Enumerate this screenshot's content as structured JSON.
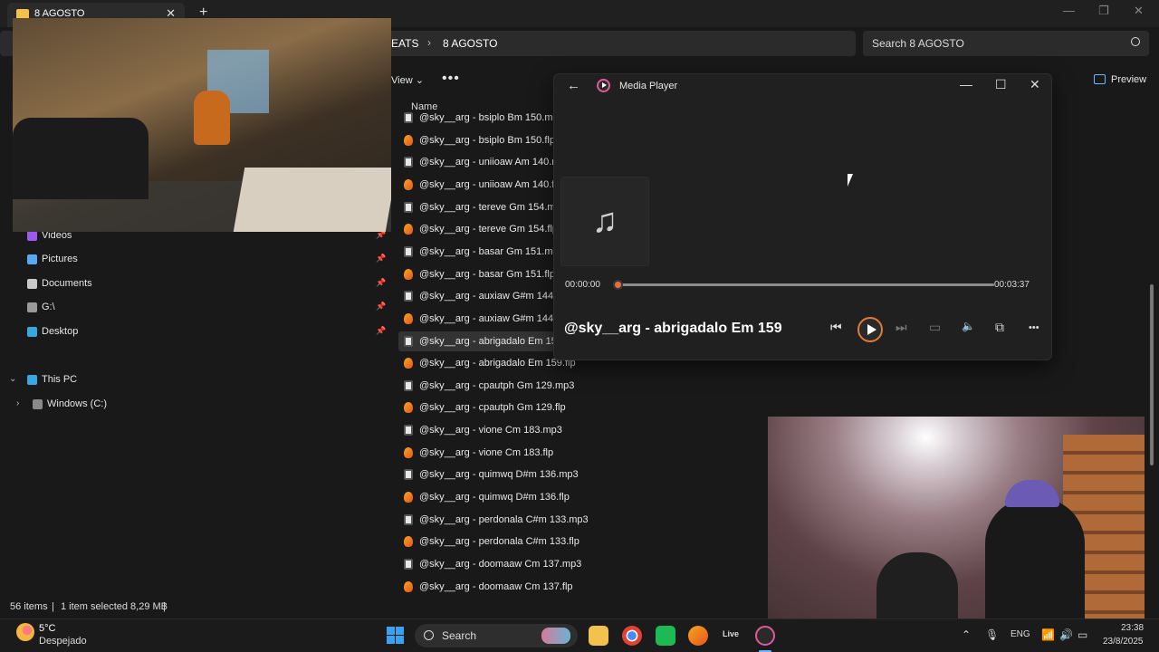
{
  "explorer": {
    "tab_title": "8 AGOSTO",
    "tab_close": "✕",
    "new_tab": "+",
    "window_controls": {
      "minimize": "—",
      "maximize": "❐",
      "close": "✕"
    },
    "breadcrumb": {
      "parent": "EATS",
      "separator": "›",
      "current": "8 AGOSTO"
    },
    "search_placeholder": "Search 8 AGOSTO",
    "toolbar": {
      "view_label": "View ⌄",
      "more": "•••",
      "preview_label": "Preview"
    },
    "column_header": "Name",
    "sidebar": {
      "quick_access": [
        {
          "label": "Videos",
          "color": "#9b59f0",
          "pinned": "📌"
        },
        {
          "label": "Pictures",
          "color": "#5aa8f0",
          "pinned": "📌"
        },
        {
          "label": "Documents",
          "color": "#c9c9c9",
          "pinned": "📌"
        },
        {
          "label": "G:\\",
          "color": "#9a9a9a",
          "pinned": "📌"
        },
        {
          "label": "Desktop",
          "color": "#3aa8e0",
          "pinned": "📌"
        }
      ],
      "this_pc": "This PC",
      "this_pc_chevron": "⌄",
      "drive": "Windows (C:)",
      "drive_chevron": "›"
    },
    "files": [
      {
        "name": "@sky__arg - bsiplo Bm 150.mp3",
        "type": "mp3"
      },
      {
        "name": "@sky__arg - bsiplo Bm 150.flp",
        "type": "flp"
      },
      {
        "name": "@sky__arg - uniioaw Am 140.mp3",
        "type": "mp3"
      },
      {
        "name": "@sky__arg - uniioaw Am 140.flp",
        "type": "flp"
      },
      {
        "name": "@sky__arg - tereve Gm 154.mp3",
        "type": "mp3"
      },
      {
        "name": "@sky__arg - tereve Gm 154.flp",
        "type": "flp"
      },
      {
        "name": "@sky__arg - basar Gm 151.mp3",
        "type": "mp3"
      },
      {
        "name": "@sky__arg - basar Gm 151.flp",
        "type": "flp"
      },
      {
        "name": "@sky__arg - auxiaw G#m 144.mp3",
        "type": "mp3"
      },
      {
        "name": "@sky__arg - auxiaw G#m 144.flp",
        "type": "flp"
      },
      {
        "name": "@sky__arg - abrigadalo Em 159.mp3",
        "type": "mp3",
        "selected": true
      },
      {
        "name": "@sky__arg - abrigadalo Em 159.flp",
        "type": "flp"
      },
      {
        "name": "@sky__arg - cpautph Gm 129.mp3",
        "type": "mp3"
      },
      {
        "name": "@sky__arg - cpautph Gm 129.flp",
        "type": "flp"
      },
      {
        "name": "@sky__arg - vione Cm 183.mp3",
        "type": "mp3"
      },
      {
        "name": "@sky__arg - vione Cm 183.flp",
        "type": "flp"
      },
      {
        "name": "@sky__arg - quimwq D#m 136.mp3",
        "type": "mp3"
      },
      {
        "name": "@sky__arg - quimwq D#m 136.flp",
        "type": "flp"
      },
      {
        "name": "@sky__arg - perdonala C#m 133.mp3",
        "type": "mp3"
      },
      {
        "name": "@sky__arg - perdonala C#m 133.flp",
        "type": "flp"
      },
      {
        "name": "@sky__arg - doomaaw Cm 137.mp3",
        "type": "mp3"
      },
      {
        "name": "@sky__arg - doomaaw Cm 137.flp",
        "type": "flp"
      }
    ],
    "status": {
      "items": "56 items",
      "sep": "|",
      "selected": "1 item selected  8,29 MB",
      "sep2": "|"
    }
  },
  "media_player": {
    "back": "←",
    "title": "Media Player",
    "controls": {
      "minimize": "—",
      "maximize": "☐",
      "close": "✕"
    },
    "art_icon": "♫",
    "current_time": "00:00:00",
    "duration": "00:03:37",
    "progress_fraction": 0,
    "song_title": "@sky__arg - abrigadalo Em 159",
    "buttons": {
      "previous": "⏮",
      "next": "⏭",
      "captions": "▭",
      "volume": "🔈",
      "miniplayer": "⧉",
      "more": "•••"
    },
    "accent": "#f06b3a"
  },
  "taskbar": {
    "weather_temp": "5°C",
    "weather_desc": "Despejado",
    "search_placeholder": "Search",
    "live_label": "Live",
    "tray": {
      "chevron": "⌃",
      "mic": "🎙",
      "wifi": "📶",
      "volume": "🔊",
      "battery": "▭"
    },
    "language": "ENG",
    "time": "23:38",
    "date": "23/8/2025"
  }
}
